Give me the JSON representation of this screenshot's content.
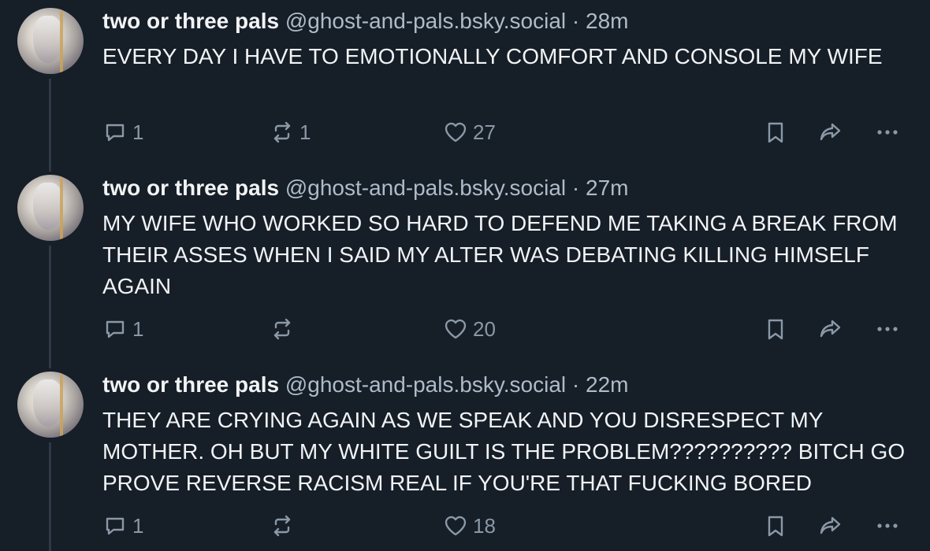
{
  "posts": [
    {
      "display_name": "two or three pals",
      "handle": "@ghost-and-pals.bsky.social",
      "separator": "·",
      "time": "28m",
      "text": "EVERY DAY I HAVE TO EMOTIONALLY COMFORT AND CONSOLE MY WIFE",
      "reply_count": "1",
      "repost_count": "1",
      "like_count": "27"
    },
    {
      "display_name": "two or three pals",
      "handle": "@ghost-and-pals.bsky.social",
      "separator": "·",
      "time": "27m",
      "text": "MY WIFE WHO WORKED SO HARD TO DEFEND ME TAKING A BREAK FROM THEIR ASSES WHEN I SAID MY ALTER WAS DEBATING KILLING HIMSELF AGAIN",
      "reply_count": "1",
      "repost_count": "",
      "like_count": "20"
    },
    {
      "display_name": "two or three pals",
      "handle": "@ghost-and-pals.bsky.social",
      "separator": "·",
      "time": "22m",
      "text": "THEY ARE CRYING AGAIN AS WE SPEAK AND YOU DISRESPECT MY MOTHER. OH BUT MY WHITE GUILT IS THE PROBLEM?????????? BITCH GO PROVE REVERSE RACISM REAL IF YOU'RE THAT FUCKING BORED",
      "reply_count": "1",
      "repost_count": "",
      "like_count": "18"
    }
  ],
  "icons": {
    "reply": "reply-icon",
    "repost": "repost-icon",
    "like": "heart-icon",
    "bookmark": "bookmark-icon",
    "share": "share-icon",
    "more": "more-icon"
  },
  "colors": {
    "background": "#161e27",
    "text": "#f1f3f5",
    "muted": "#aebbc9",
    "icon": "#8a98a7",
    "thread_line": "#2e3946"
  }
}
